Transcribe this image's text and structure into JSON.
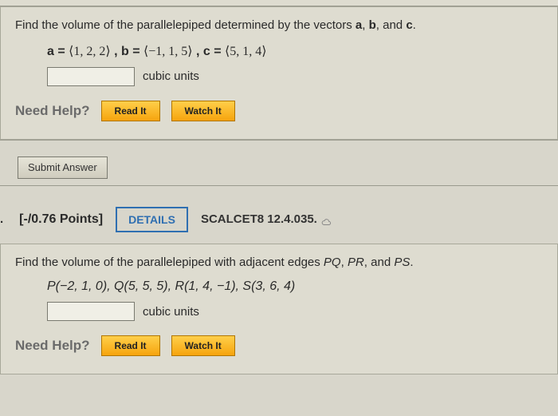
{
  "q1": {
    "prompt_pre": "Find the volume of the parallelepiped determined by the vectors ",
    "vec_a_label": "a",
    "vec_b_label": "b",
    "vec_c_label": "c",
    "prompt_mid1": ", ",
    "prompt_mid2": ", and ",
    "prompt_end": ".",
    "eq_a_pre": "a = ",
    "eq_a_val": "⟨1, 2, 2⟩",
    "eq_b_pre": ",   b = ",
    "eq_b_val": "⟨−1, 1, 5⟩",
    "eq_c_pre": ",   c = ",
    "eq_c_val": "⟨5, 1, 4⟩",
    "units": "cubic units",
    "help_label": "Need Help?",
    "read": "Read It",
    "watch": "Watch It",
    "submit": "Submit Answer"
  },
  "q2": {
    "points": "[-/0.76 Points]",
    "details": "DETAILS",
    "ref": "SCALCET8 12.4.035.",
    "prompt_pre": "Find the volume of the parallelepiped with adjacent edges ",
    "e1": "PQ",
    "e2": "PR",
    "e3": "PS",
    "sep1": ", ",
    "sep2": ",  and ",
    "prompt_end": ".",
    "pts": "P(−2, 1, 0), Q(5, 5, 5), R(1, 4, −1), S(3, 6, 4)",
    "units": "cubic units",
    "help_label": "Need Help?",
    "read": "Read It",
    "watch": "Watch It"
  }
}
